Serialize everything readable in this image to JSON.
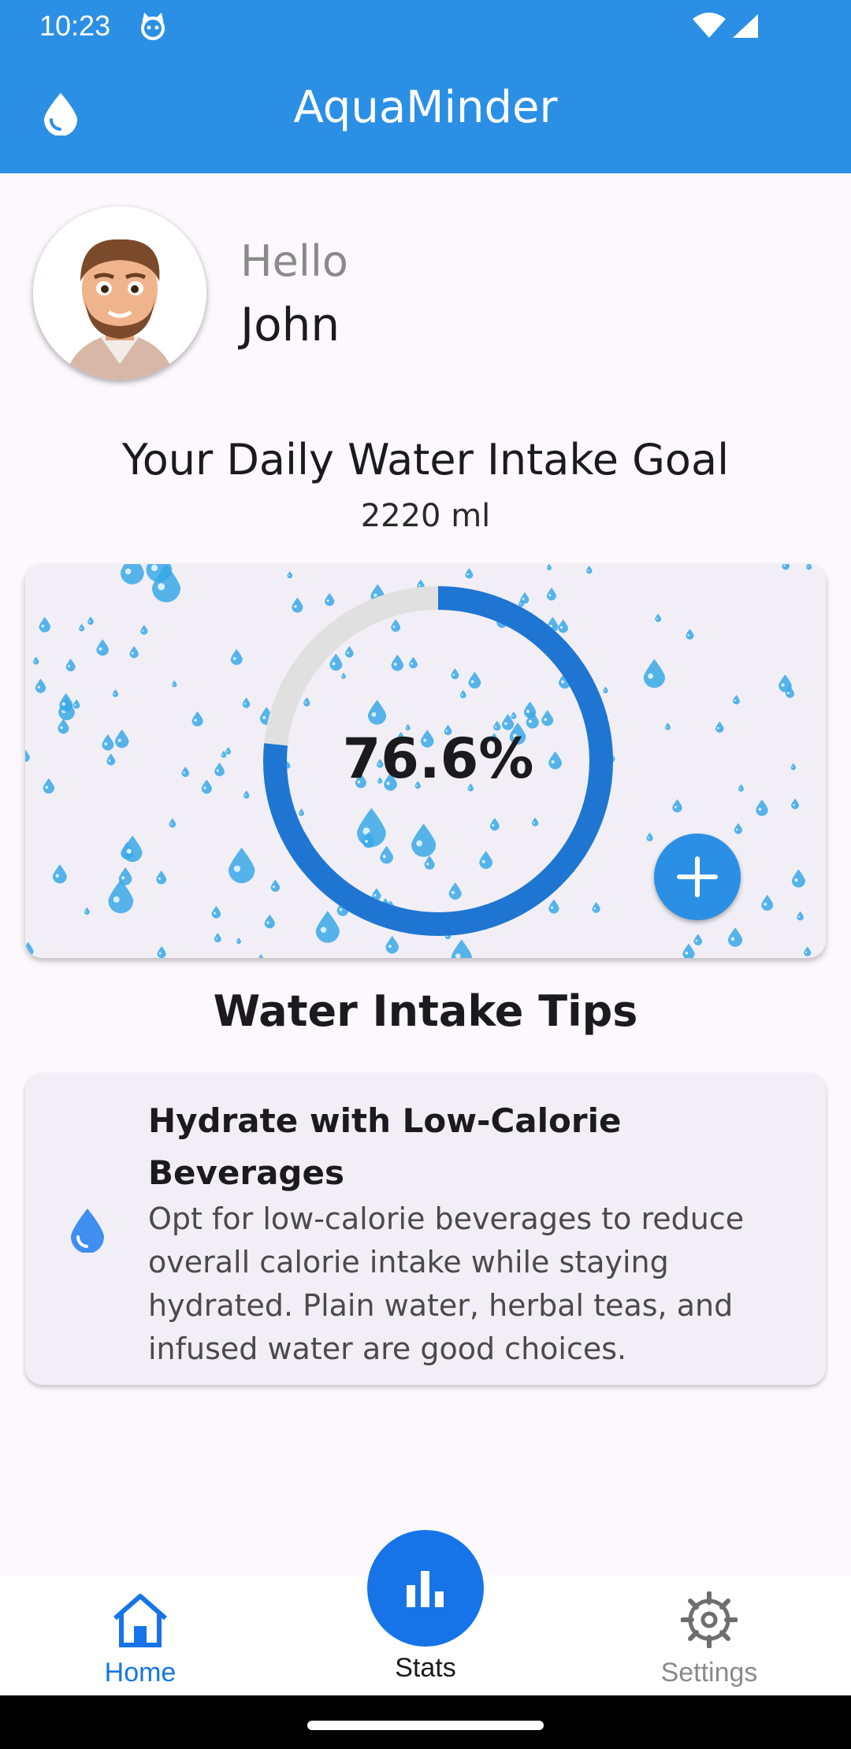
{
  "status_bar": {
    "time": "10:23"
  },
  "app_bar": {
    "title": "AquaMinder"
  },
  "greeting": {
    "hello": "Hello",
    "name": "John"
  },
  "goal": {
    "title": "Your Daily Water Intake Goal",
    "value": "2220 ml"
  },
  "progress": {
    "percent_label": "76.6%",
    "fraction": 0.766
  },
  "tips": {
    "section_title": "Water Intake Tips",
    "card": {
      "heading": "Hydrate with Low-Calorie Beverages",
      "body": "Opt for low-calorie beverages to reduce overall calorie intake while staying hydrated. Plain water, herbal teas, and infused water are good choices."
    }
  },
  "nav": {
    "home": "Home",
    "stats": "Stats",
    "settings": "Settings"
  },
  "icons": {
    "app_bar": "water-drop-icon",
    "tip": "water-drop-icon",
    "add": "plus-icon",
    "home": "home-icon",
    "stats": "bar-chart-icon",
    "settings": "gear-icon"
  },
  "colors": {
    "primary": "#2b8fe5",
    "accent": "#1674e8",
    "ring_fill": "#1e76d2",
    "ring_track": "#e0e0e0"
  }
}
